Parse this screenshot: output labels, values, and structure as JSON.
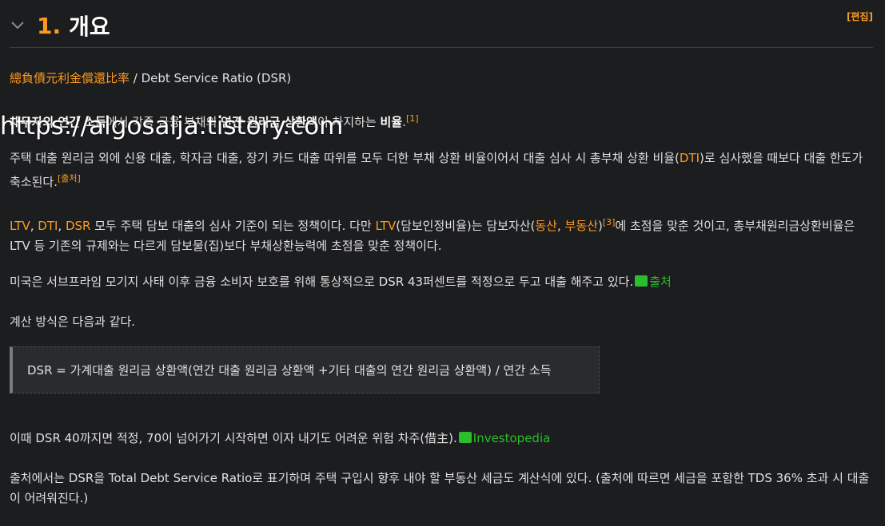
{
  "heading": {
    "number": "1.",
    "title": "개요",
    "edit": "[편집]"
  },
  "p1": {
    "hanja": "總負債元利金償還比率",
    "rest": " / Debt Service Ratio (DSR)"
  },
  "p2": {
    "a": "채무자의 연간 소득",
    "b": "에서 각종 금융 부채의 ",
    "c": "연간 원리금 상환액",
    "d": "이 차지하는 ",
    "e": "비율",
    "f": ".",
    "sup": "[1]"
  },
  "watermark": "https://algosalja.tistory.com",
  "p3": {
    "a": "주택 대출 원리금 외에 신용 대출, 학자금 대출, 장기 카드 대출 따위를 모두 더한 부채 상환 비율이어서 대출 심사 시 총부채 상환 비율(",
    "dti": "DTI",
    "b": ")로 심사했을 때보다 대출 한도가 축소된다.",
    "sup": "[출처]"
  },
  "p4": {
    "ltv": "LTV",
    "sep1": ", ",
    "dti": "DTI",
    "sep2": ", ",
    "dsr": "DSR",
    "a": " 모두 주택 담보 대출의 심사 기준이 되는 정책이다. 다만 ",
    "ltv2": "LTV",
    "b": "(담보인정비율)는 담보자산(",
    "c1": "동산",
    "sep3": ", ",
    "c2": "부동산",
    "c": ")",
    "sup": "[3]",
    "d": "에 초점을 맞춘 것이고, 총부채원리금상환비율은 LTV 등 기존의 규제와는 다르게 담보물(집)보다 부채상환능력에 초점을 맞춘 정책이다."
  },
  "p5": {
    "text": "미국은 서브프라임 모기지 사태 이후 금융 소비자 보호를 위해 통상적으로 DSR 43퍼센트를 적정으로 두고 대출 해주고 있다.",
    "link": "출처"
  },
  "p6": {
    "text": "계산 방식은 다음과 같다."
  },
  "formula": "DSR = 가계대출 원리금 상환액(연간 대출 원리금 상환액 +기타 대출의 연간 원리금 상환액) / 연간 소득",
  "p7": {
    "text": "이때 DSR 40까지면 적정, 70이 넘어가기 시작하면 이자 내기도 어려운 위험 차주(借主).",
    "link": "Investopedia"
  },
  "p8": {
    "text": "출처에서는 DSR을 Total Debt Service Ratio로 표기하며 주택 구입시 향후 내야 할 부동산 세금도 계산식에 있다. (출처에 따르면 세금을 포함한 TDS 36% 초과 시 대출이 어려워진다.)"
  }
}
